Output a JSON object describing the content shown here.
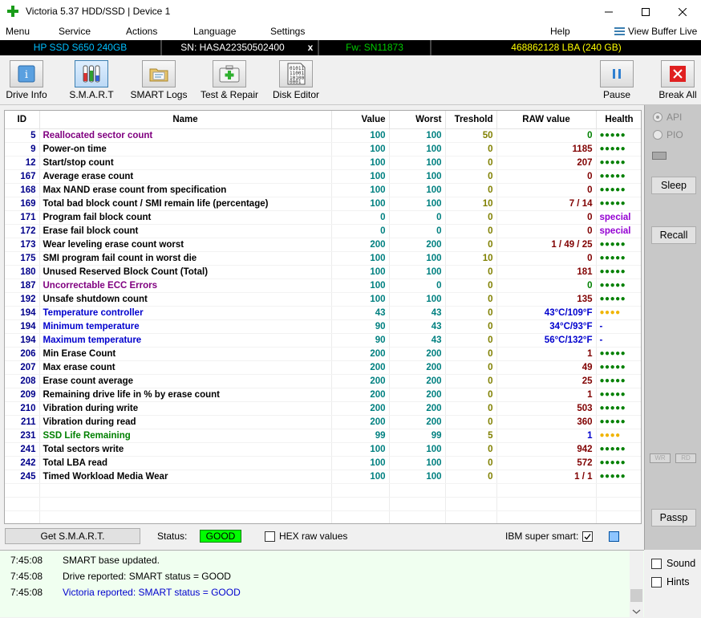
{
  "window": {
    "title": "Victoria 5.37 HDD/SSD | Device 1",
    "minimize_glyph": "—",
    "maximize_glyph": "☐",
    "close_glyph": "✕"
  },
  "menu": {
    "items": [
      "Menu",
      "Service",
      "Actions",
      "Language",
      "Settings",
      "Help"
    ],
    "view_buffer": "View Buffer Live"
  },
  "info_bar": {
    "model": "HP SSD S650 240GB",
    "serial": "SN: HASA22350502400",
    "close": "x",
    "firmware": "Fw: SN11873",
    "capacity": "468862128 LBA (240 GB)",
    "colors": {
      "model": "#00bfff",
      "serial": "#ffffff",
      "firmware": "#00cc00",
      "capacity": "#ffff00"
    }
  },
  "toolbar": {
    "buttons": [
      {
        "label": "Drive Info",
        "icon": "info-icon"
      },
      {
        "label": "S.M.A.R.T",
        "icon": "test-tubes-icon"
      },
      {
        "label": "SMART Logs",
        "icon": "folder-icon"
      },
      {
        "label": "Test & Repair",
        "icon": "medkit-icon"
      },
      {
        "label": "Disk Editor",
        "icon": "binary-doc-icon"
      }
    ],
    "pause": "Pause",
    "break_all": "Break All"
  },
  "smart_table": {
    "headers": [
      "ID",
      "Name",
      "Value",
      "Worst",
      "Treshold",
      "RAW value",
      "Health"
    ],
    "rows": [
      {
        "id": "5",
        "name": "Reallocated sector count",
        "value": "100",
        "worst": "100",
        "threshold": "50",
        "raw": "0",
        "health": "●●●●●",
        "name_style": "bad",
        "raw_style": "green",
        "health_style": "good"
      },
      {
        "id": "9",
        "name": "Power-on time",
        "value": "100",
        "worst": "100",
        "threshold": "0",
        "raw": "1185",
        "health": "●●●●●",
        "name_style": "",
        "raw_style": "",
        "health_style": "good"
      },
      {
        "id": "12",
        "name": "Start/stop count",
        "value": "100",
        "worst": "100",
        "threshold": "0",
        "raw": "207",
        "health": "●●●●●",
        "name_style": "",
        "raw_style": "",
        "health_style": "good"
      },
      {
        "id": "167",
        "name": "Average erase count",
        "value": "100",
        "worst": "100",
        "threshold": "0",
        "raw": "0",
        "health": "●●●●●",
        "name_style": "",
        "raw_style": "",
        "health_style": "good"
      },
      {
        "id": "168",
        "name": "Max NAND erase count from specification",
        "value": "100",
        "worst": "100",
        "threshold": "0",
        "raw": "0",
        "health": "●●●●●",
        "name_style": "",
        "raw_style": "",
        "health_style": "good"
      },
      {
        "id": "169",
        "name": "Total bad block count / SMI remain life (percentage)",
        "value": "100",
        "worst": "100",
        "threshold": "10",
        "raw": "7 / 14",
        "health": "●●●●●",
        "name_style": "",
        "raw_style": "",
        "health_style": "good"
      },
      {
        "id": "171",
        "name": "Program fail block count",
        "value": "0",
        "worst": "0",
        "threshold": "0",
        "raw": "0",
        "health": "special",
        "name_style": "",
        "raw_style": "",
        "health_style": "special"
      },
      {
        "id": "172",
        "name": "Erase fail block count",
        "value": "0",
        "worst": "0",
        "threshold": "0",
        "raw": "0",
        "health": "special",
        "name_style": "",
        "raw_style": "",
        "health_style": "special"
      },
      {
        "id": "173",
        "name": "Wear leveling erase count worst",
        "value": "200",
        "worst": "200",
        "threshold": "0",
        "raw": "1 / 49 / 25",
        "health": "●●●●●",
        "name_style": "",
        "raw_style": "",
        "health_style": "good"
      },
      {
        "id": "175",
        "name": "SMI program fail count in worst die",
        "value": "100",
        "worst": "100",
        "threshold": "10",
        "raw": "0",
        "health": "●●●●●",
        "name_style": "",
        "raw_style": "",
        "health_style": "good"
      },
      {
        "id": "180",
        "name": "Unused Reserved Block Count (Total)",
        "value": "100",
        "worst": "100",
        "threshold": "0",
        "raw": "181",
        "health": "●●●●●",
        "name_style": "",
        "raw_style": "",
        "health_style": "good"
      },
      {
        "id": "187",
        "name": "Uncorrectable ECC Errors",
        "value": "100",
        "worst": "0",
        "threshold": "0",
        "raw": "0",
        "health": "●●●●●",
        "name_style": "bad",
        "raw_style": "green",
        "health_style": "good"
      },
      {
        "id": "192",
        "name": "Unsafe shutdown count",
        "value": "100",
        "worst": "100",
        "threshold": "0",
        "raw": "135",
        "health": "●●●●●",
        "name_style": "",
        "raw_style": "",
        "health_style": "good"
      },
      {
        "id": "194",
        "name": "Temperature controller",
        "value": "43",
        "worst": "43",
        "threshold": "0",
        "raw": "43°C/109°F",
        "health": "●●●●",
        "name_style": "temp",
        "raw_style": "temp",
        "health_style": "warn"
      },
      {
        "id": "194",
        "name": "Minimum temperature",
        "value": "90",
        "worst": "43",
        "threshold": "0",
        "raw": "34°C/93°F",
        "health": "-",
        "name_style": "temp",
        "raw_style": "temp",
        "health_style": "dash"
      },
      {
        "id": "194",
        "name": "Maximum temperature",
        "value": "90",
        "worst": "43",
        "threshold": "0",
        "raw": "56°C/132°F",
        "health": "-",
        "name_style": "temp",
        "raw_style": "temp",
        "health_style": "dash"
      },
      {
        "id": "206",
        "name": "Min Erase Count",
        "value": "200",
        "worst": "200",
        "threshold": "0",
        "raw": "1",
        "health": "●●●●●",
        "name_style": "",
        "raw_style": "",
        "health_style": "good"
      },
      {
        "id": "207",
        "name": "Max erase count",
        "value": "200",
        "worst": "200",
        "threshold": "0",
        "raw": "49",
        "health": "●●●●●",
        "name_style": "",
        "raw_style": "",
        "health_style": "good"
      },
      {
        "id": "208",
        "name": "Erase count average",
        "value": "200",
        "worst": "200",
        "threshold": "0",
        "raw": "25",
        "health": "●●●●●",
        "name_style": "",
        "raw_style": "",
        "health_style": "good"
      },
      {
        "id": "209",
        "name": "Remaining drive life in % by erase count",
        "value": "200",
        "worst": "200",
        "threshold": "0",
        "raw": "1",
        "health": "●●●●●",
        "name_style": "",
        "raw_style": "",
        "health_style": "good"
      },
      {
        "id": "210",
        "name": "Vibration during write",
        "value": "200",
        "worst": "200",
        "threshold": "0",
        "raw": "503",
        "health": "●●●●●",
        "name_style": "",
        "raw_style": "",
        "health_style": "good"
      },
      {
        "id": "211",
        "name": "Vibration during read",
        "value": "200",
        "worst": "200",
        "threshold": "0",
        "raw": "360",
        "health": "●●●●●",
        "name_style": "",
        "raw_style": "",
        "health_style": "good"
      },
      {
        "id": "231",
        "name": "SSD Life Remaining",
        "value": "99",
        "worst": "99",
        "threshold": "5",
        "raw": "1",
        "health": "●●●●",
        "name_style": "good",
        "raw_style": "temp",
        "health_style": "warn"
      },
      {
        "id": "241",
        "name": "Total sectors write",
        "value": "100",
        "worst": "100",
        "threshold": "0",
        "raw": "942",
        "health": "●●●●●",
        "name_style": "",
        "raw_style": "",
        "health_style": "good"
      },
      {
        "id": "242",
        "name": "Total LBA read",
        "value": "100",
        "worst": "100",
        "threshold": "0",
        "raw": "572",
        "health": "●●●●●",
        "name_style": "",
        "raw_style": "",
        "health_style": "good"
      },
      {
        "id": "245",
        "name": "Timed Workload Media Wear",
        "value": "100",
        "worst": "100",
        "threshold": "0",
        "raw": "1 / 1",
        "health": "●●●●●",
        "name_style": "",
        "raw_style": "",
        "health_style": "good"
      }
    ],
    "empty_rows": 3
  },
  "status_row": {
    "get_smart": "Get S.M.A.R.T.",
    "status_label": "Status:",
    "status_value": "GOOD",
    "hex_raw": "HEX raw values",
    "hex_raw_checked": false,
    "ibm_super_smart": "IBM super smart:",
    "ibm_checked": true
  },
  "right_panel": {
    "api": "API",
    "pio": "PIO",
    "sleep": "Sleep",
    "recall": "Recall",
    "wr": "WR",
    "rd": "RD",
    "passp": "Passp"
  },
  "log": [
    {
      "time": "7:45:08",
      "message": "SMART base updated.",
      "color": "#000000"
    },
    {
      "time": "7:45:08",
      "message": "Drive reported: SMART status = GOOD",
      "color": "#000000"
    },
    {
      "time": "7:45:08",
      "message": "Victoria reported: SMART status = GOOD",
      "color": "#0000cd"
    }
  ],
  "bottom_right": {
    "sound": "Sound",
    "hints": "Hints"
  }
}
